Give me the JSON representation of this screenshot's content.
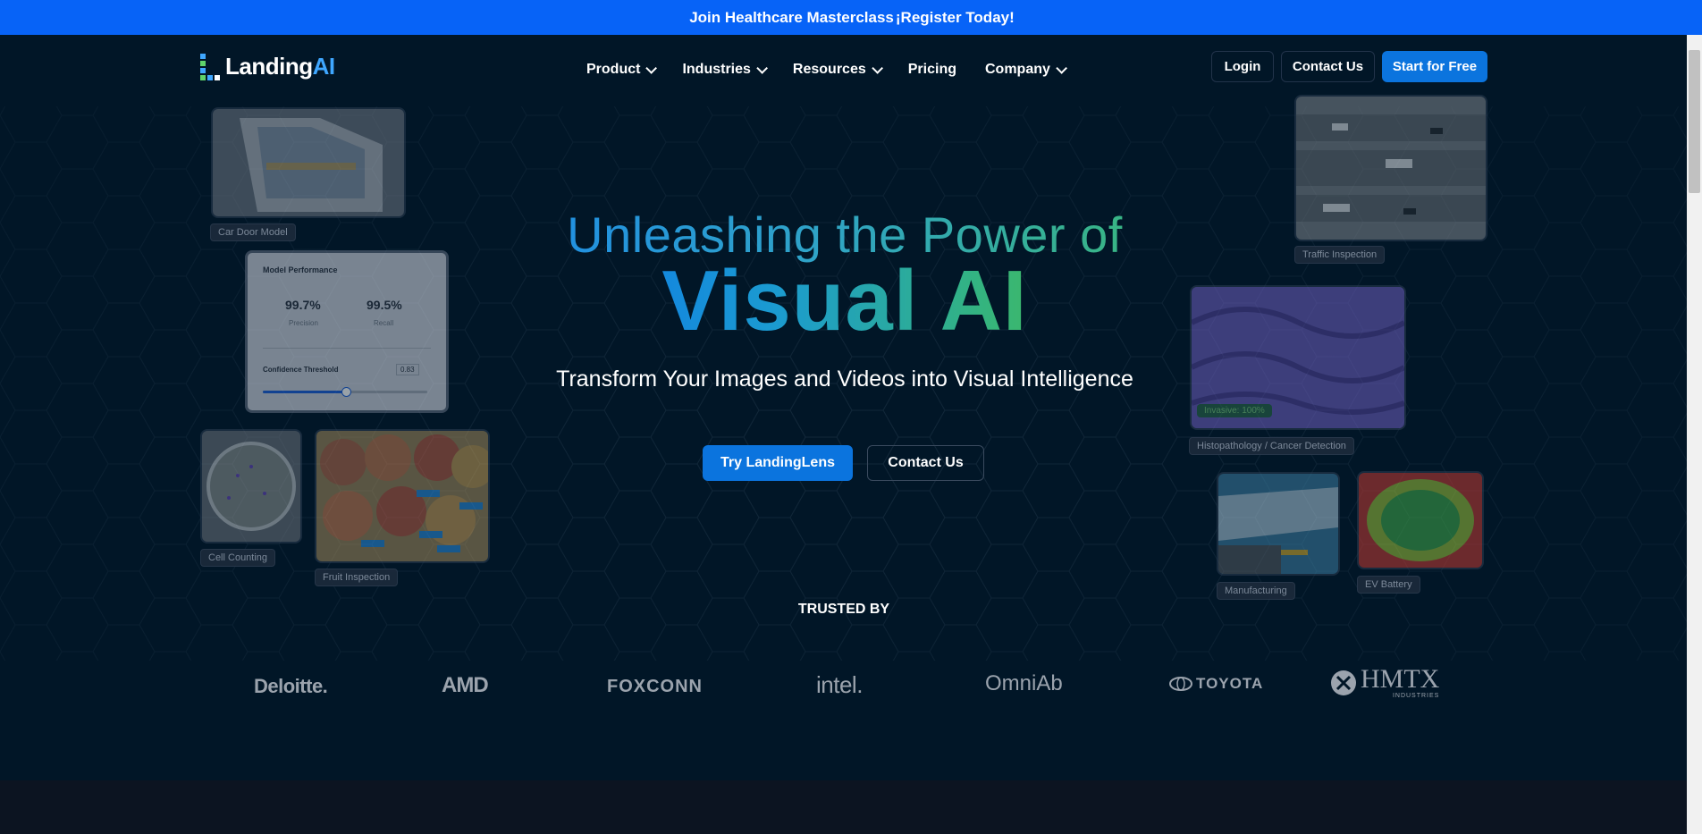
{
  "announcement": {
    "prefix": "Join Healthcare Masterclass",
    "cta": "¡Register Today!"
  },
  "brand": {
    "name_main": "Landing",
    "name_ai": "AI"
  },
  "nav": {
    "items": [
      {
        "label": "Product",
        "has_dropdown": true
      },
      {
        "label": "Industries",
        "has_dropdown": true
      },
      {
        "label": "Resources",
        "has_dropdown": true
      },
      {
        "label": "Pricing",
        "has_dropdown": false
      },
      {
        "label": "Company",
        "has_dropdown": true
      }
    ],
    "login": "Login",
    "contact": "Contact Us",
    "start": "Start for Free"
  },
  "hero": {
    "headline_line1": "Unleashing the Power of",
    "headline_line2": "Visual AI",
    "subtitle": "Transform Your Images and Videos into Visual Intelligence",
    "primary_cta": "Try LandingLens",
    "secondary_cta": "Contact Us"
  },
  "cards": {
    "car_door": "Car Door Model",
    "performance": {
      "title": "Model Performance",
      "precision_value": "99.7%",
      "precision_label": "Precision",
      "recall_value": "99.5%",
      "recall_label": "Recall",
      "threshold_label": "Confidence Threshold",
      "threshold_value": "0.83",
      "slider_fraction": 0.5
    },
    "cell_counting": "Cell Counting",
    "fruit_inspection": "Fruit Inspection",
    "traffic": "Traffic Inspection",
    "histopathology": "Histopathology / Cancer Detection",
    "histo_badge": "Invasive: 100%",
    "manufacturing": "Manufacturing",
    "ev_battery": "EV Battery"
  },
  "trusted": {
    "heading": "TRUSTED BY",
    "logos": [
      "Deloitte.",
      "AMD",
      "FOXCONN",
      "intel.",
      "OmniAb",
      "TOYOTA",
      "HMTX",
      "INDUSTRIES"
    ]
  },
  "colors": {
    "announce_bg": "#0763f7",
    "bg": "#011627",
    "primary": "#0b74de"
  }
}
